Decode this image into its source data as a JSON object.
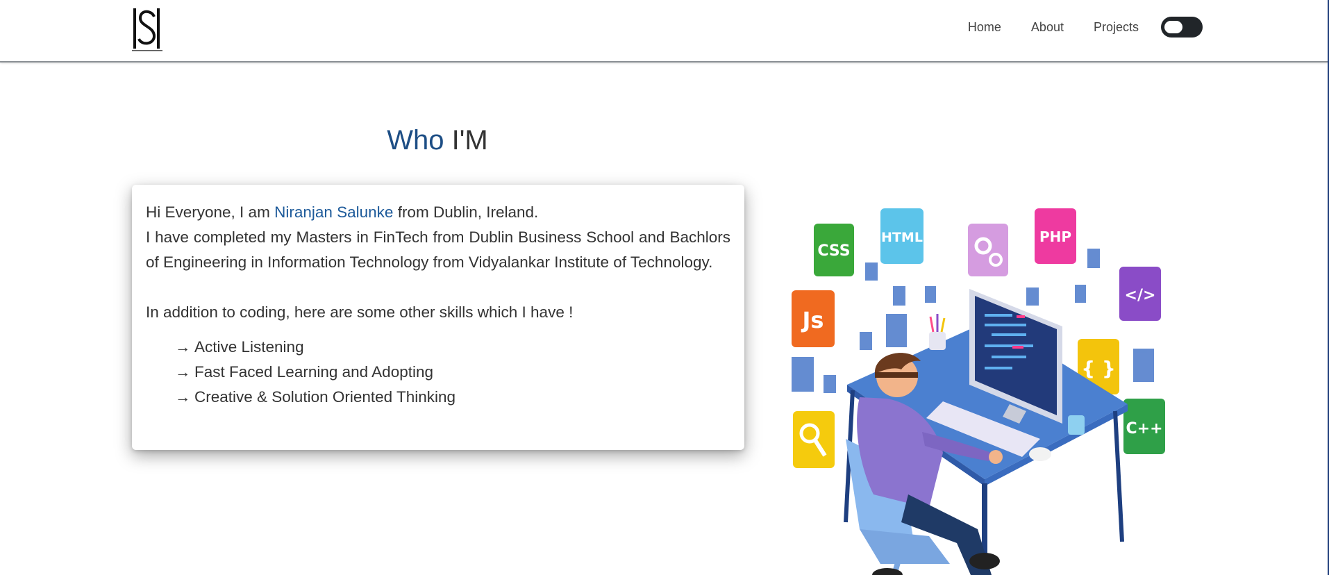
{
  "navbar": {
    "logo_alt": "NS",
    "links": [
      {
        "label": "Home"
      },
      {
        "label": "About"
      },
      {
        "label": "Projects"
      }
    ],
    "theme_toggle": "dark-mode-toggle"
  },
  "about": {
    "title_accent": "Who",
    "title_rest": "I'M",
    "intro_prefix": "Hi Everyone, I am ",
    "name": "Niranjan Salunke",
    "intro_suffix": " from Dublin, Ireland.",
    "education": "I have completed my Masters in FinTech from Dublin Business School and Bachlors of Engineering in Information Technology from Vidyalankar Institute of Technology.",
    "skills_intro": "In addition to coding, here are some other skills which I have !",
    "skills": [
      "Active Listening",
      "Fast Faced Learning and Adopting",
      "Creative & Solution Oriented Thinking"
    ]
  },
  "illustration": {
    "badges": [
      "CSS",
      "HTML",
      "PHP",
      "</>",
      "Js",
      "{ }",
      "C++"
    ]
  },
  "colors": {
    "accent": "#1d4e85",
    "name_link": "#1d5a9a",
    "toggle": "#212529"
  }
}
